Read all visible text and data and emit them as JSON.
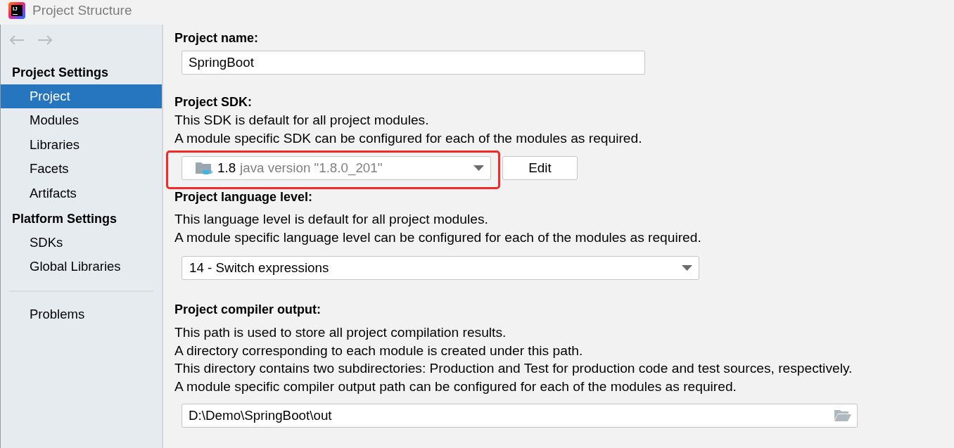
{
  "window": {
    "title": "Project Structure",
    "logo_text": "IJ"
  },
  "sidebar": {
    "nav_buttons": [
      {
        "kind": "back",
        "disabled": true
      },
      {
        "kind": "forward",
        "disabled": true
      }
    ],
    "sections": [
      {
        "heading": "Project Settings",
        "items": [
          {
            "label": "Project",
            "selected": true
          },
          {
            "label": "Modules",
            "selected": false
          },
          {
            "label": "Libraries",
            "selected": false
          },
          {
            "label": "Facets",
            "selected": false
          },
          {
            "label": "Artifacts",
            "selected": false
          }
        ]
      },
      {
        "heading": "Platform Settings",
        "items": [
          {
            "label": "SDKs",
            "selected": false
          },
          {
            "label": "Global Libraries",
            "selected": false
          }
        ]
      },
      {
        "items": [
          {
            "label": "Problems",
            "selected": false
          }
        ]
      }
    ]
  },
  "project_name": {
    "label": "Project name:",
    "value": "SpringBoot"
  },
  "project_sdk": {
    "label": "Project SDK:",
    "description": [
      "This SDK is default for all project modules.",
      "A module specific SDK can be configured for each of the modules as required."
    ],
    "dropdown": {
      "name": "1.8",
      "detail": "java version \"1.8.0_201\"",
      "highlighted": true
    },
    "edit_button": "Edit"
  },
  "language_level": {
    "label": "Project language level:",
    "description": [
      "This language level is default for all project modules.",
      "A module specific language level can be configured for each of the modules as required."
    ],
    "dropdown": {
      "value": "14 - Switch expressions"
    }
  },
  "compiler_output": {
    "label": "Project compiler output:",
    "description": [
      "This path is used to store all project compilation results.",
      "A directory corresponding to each module is created under this path.",
      "This directory contains two subdirectories: Production and Test for production code and test sources, respectively.",
      "A module specific compiler output path can be configured for each of the modules as required."
    ],
    "field": {
      "value": "D:\\Demo\\SpringBoot\\out"
    }
  }
}
